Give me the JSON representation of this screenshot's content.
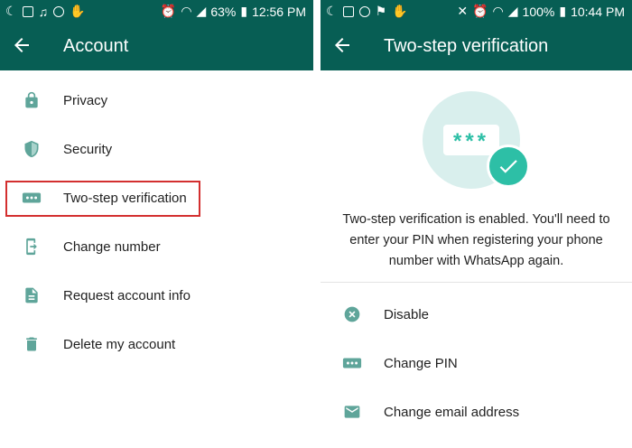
{
  "left": {
    "status": {
      "battery": "63%",
      "time": "12:56 PM"
    },
    "appbar": {
      "title": "Account"
    },
    "items": [
      {
        "label": "Privacy",
        "icon": "lock-icon"
      },
      {
        "label": "Security",
        "icon": "shield-icon"
      },
      {
        "label": "Two-step verification",
        "icon": "dots-icon",
        "highlighted": true
      },
      {
        "label": "Change number",
        "icon": "change-number-icon"
      },
      {
        "label": "Request account info",
        "icon": "document-icon"
      },
      {
        "label": "Delete my account",
        "icon": "trash-icon"
      }
    ]
  },
  "right": {
    "status": {
      "battery": "100%",
      "time": "10:44 PM"
    },
    "appbar": {
      "title": "Two-step verification"
    },
    "hero": {
      "pin_mask": "***"
    },
    "info": "Two-step verification is enabled. You'll need to enter your PIN when registering your phone number with WhatsApp again.",
    "items": [
      {
        "label": "Disable",
        "icon": "disable-icon"
      },
      {
        "label": "Change PIN",
        "icon": "dots-icon"
      },
      {
        "label": "Change email address",
        "icon": "mail-icon"
      }
    ]
  },
  "colors": {
    "appbar": "#075e54",
    "icon": "#5fa59a",
    "accent": "#2dbfa6",
    "highlight": "#d32f2f"
  }
}
